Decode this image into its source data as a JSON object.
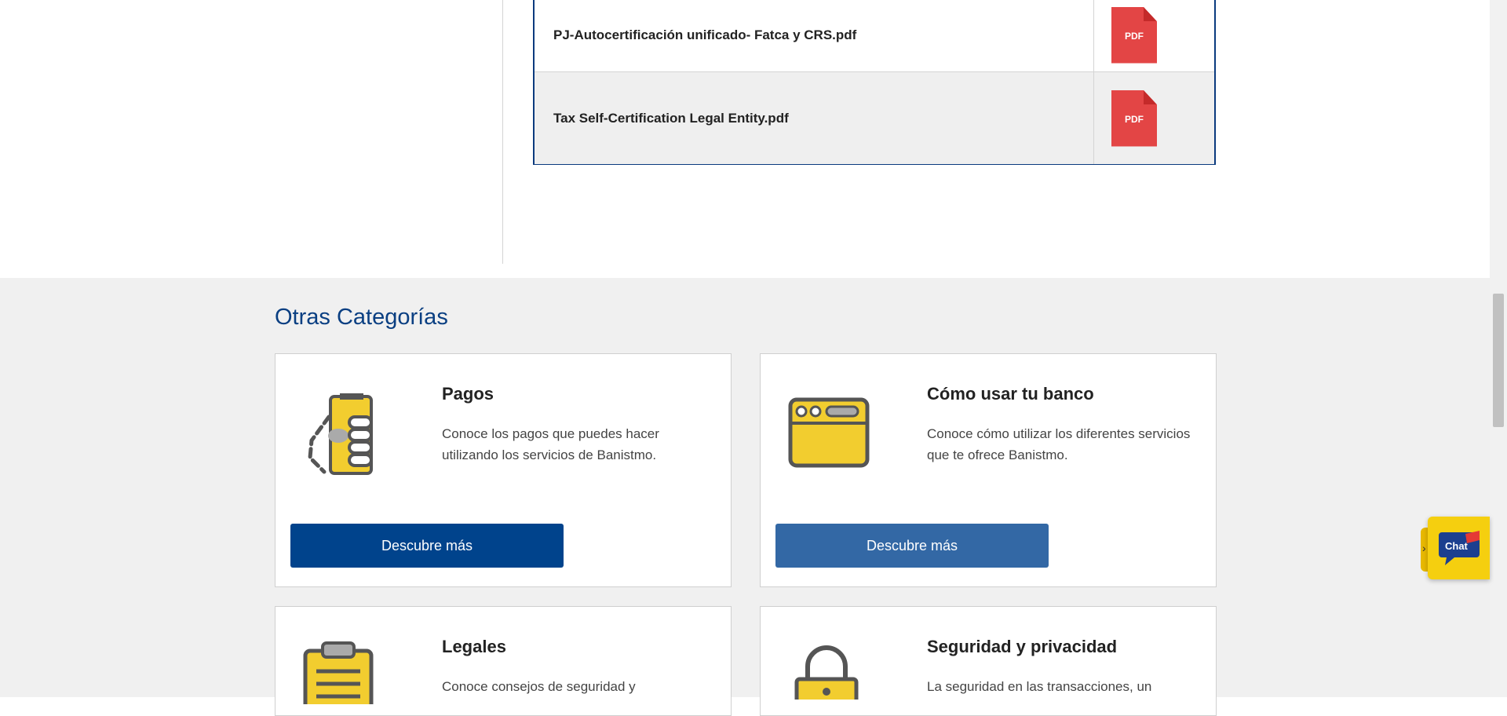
{
  "documents": [
    {
      "name": "PJ-Autocertificación unificado- Fatca y CRS.pdf",
      "icon": "pdf-file-icon",
      "badge": "PDF"
    },
    {
      "name": "Tax Self-Certification Legal Entity.pdf",
      "icon": "pdf-file-icon",
      "badge": "PDF"
    }
  ],
  "other_categories": {
    "title": "Otras Categorías",
    "cards": [
      {
        "title": "Pagos",
        "description": "Conoce los pagos que puedes hacer utilizando los servicios de Banistmo.",
        "button": "Descubre más",
        "icon": "payment-hand-icon",
        "button_color": "#00438c"
      },
      {
        "title": "Cómo usar tu banco",
        "description": "Conoce cómo utilizar los diferentes servicios que te ofrece Banistmo.",
        "button": "Descubre más",
        "icon": "browser-window-icon",
        "button_color": "#3368a5"
      },
      {
        "title": "Legales",
        "description": "Conoce consejos de seguridad y",
        "icon": "clipboard-icon"
      },
      {
        "title": "Seguridad y privacidad",
        "description": "La seguridad en las transacciones, un",
        "icon": "padlock-icon"
      }
    ]
  },
  "chat": {
    "label": "Chat",
    "icon": "chat-bubble-icon"
  },
  "colors": {
    "brand_blue": "#0a3f82",
    "accent_yellow": "#f5cf0f",
    "pdf_red": "#e34545"
  }
}
